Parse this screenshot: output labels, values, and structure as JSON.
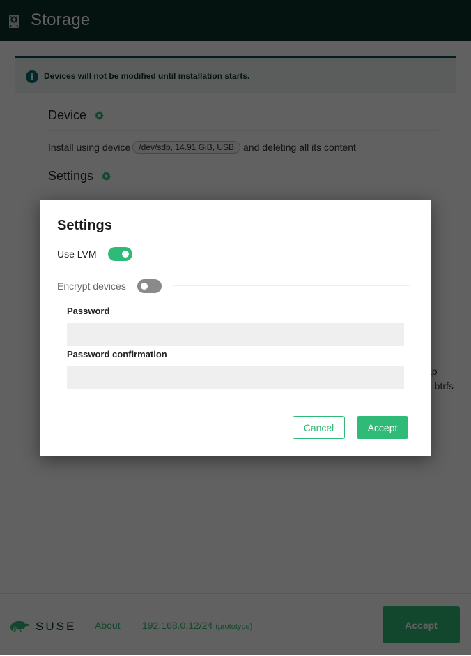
{
  "header": {
    "title": "Storage",
    "icon": "hard-drive-icon"
  },
  "alert": {
    "icon": "info-icon",
    "message": "Devices will not be modified until installation starts."
  },
  "sections": {
    "device": {
      "title": "Device",
      "icon": "gear-icon",
      "text_before": "Install using device",
      "device_chip": "/dev/sdb, 14.91 GiB, USB",
      "text_after": "and deleting all its content"
    },
    "settings": {
      "title": "Settings",
      "icon": "gear-icon"
    },
    "background_fragments": [
      "ap",
      "n btrfs"
    ]
  },
  "modal": {
    "title": "Settings",
    "use_lvm": {
      "label": "Use LVM",
      "checked": true
    },
    "encrypt_devices": {
      "label": "Encrypt devices",
      "checked": false
    },
    "password": {
      "label": "Password",
      "value": "",
      "placeholder": ""
    },
    "password_confirmation": {
      "label": "Password confirmation",
      "value": "",
      "placeholder": ""
    },
    "cancel_label": "Cancel",
    "accept_label": "Accept"
  },
  "footer": {
    "logo_text": "SUSE",
    "about_label": "About",
    "ip": "192.168.0.12/24",
    "ip_note": "(prototype)",
    "accept_label": "Accept"
  },
  "colors": {
    "header_bg": "#0c322c",
    "accent": "#30ba78",
    "alert_border": "#0a4f57",
    "info": "#0a6b72",
    "toggle_off": "#8a8a8a",
    "input_bg": "#efefef"
  }
}
